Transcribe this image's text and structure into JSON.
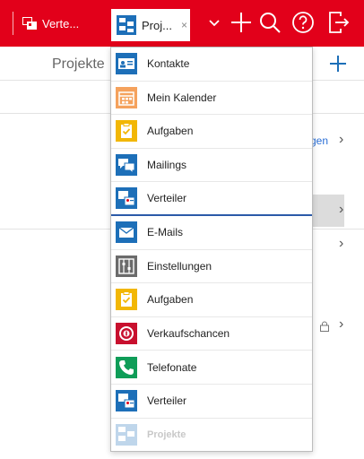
{
  "tabs": [
    {
      "label": "Verte...",
      "icon": "distribution-list-icon"
    },
    {
      "label": "Proj...",
      "icon": "projects-icon",
      "close": "×"
    }
  ],
  "toolbar_icons": [
    "chevron-down-icon",
    "plus-icon",
    "search-icon",
    "help-icon",
    "logout-icon"
  ],
  "page": {
    "title": "Projekte",
    "link_text": "gen",
    "chevron": "›"
  },
  "menu": {
    "items": [
      {
        "label": "Kontakte",
        "icon": "contacts-icon"
      },
      {
        "label": "Mein Kalender",
        "icon": "calendar-icon"
      },
      {
        "label": "Aufgaben",
        "icon": "tasks-icon"
      },
      {
        "label": "Mailings",
        "icon": "mailings-icon"
      },
      {
        "label": "Verteiler",
        "icon": "distribution-list-icon"
      },
      {
        "label": "E-Mails",
        "icon": "email-icon"
      },
      {
        "label": "Einstellungen",
        "icon": "settings-icon"
      },
      {
        "label": "Aufgaben",
        "icon": "tasks-icon"
      },
      {
        "label": "Verkaufschancen",
        "icon": "sales-opportunities-icon"
      },
      {
        "label": "Telefonate",
        "icon": "phone-icon"
      },
      {
        "label": "Verteiler",
        "icon": "distribution-list-icon"
      },
      {
        "label": "Projekte",
        "icon": "projects-icon"
      }
    ]
  },
  "colors": {
    "brand": "#e2001a",
    "active_underline": "#2b5aa8",
    "link": "#2b6fd6"
  }
}
